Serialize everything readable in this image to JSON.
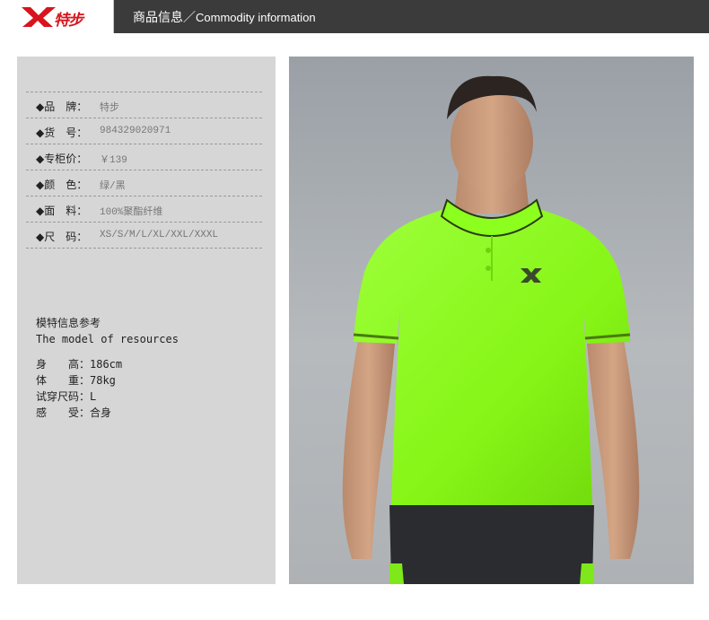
{
  "header": {
    "brand": "特步",
    "title_cn": "商品信息／",
    "title_en": "Commodity information",
    "brand_color": "#d8141c"
  },
  "specs": [
    {
      "label": "◆品　牌：",
      "value": "特步"
    },
    {
      "label": "◆货　号：",
      "value": "984329020971"
    },
    {
      "label": "◆专柜价：",
      "value": "￥139"
    },
    {
      "label": "◆颜　色：",
      "value": "绿/黑"
    },
    {
      "label": "◆面　料：",
      "value": "100%聚酯纤维"
    },
    {
      "label": "◆尺　码：",
      "value": "XS/S/M/L/XL/XXL/XXXL"
    }
  ],
  "model": {
    "title_cn": "模特信息参考",
    "title_en": "The model of resources",
    "rows": [
      "身　　高：186cm",
      "体　　重：78kg",
      "试穿尺码：L",
      "感　　受：合身"
    ]
  },
  "photo": {
    "subject": "model-wearing-polo-shirt",
    "shirt_color": "#8cff1e",
    "shorts_color": "#2a2c2f"
  }
}
